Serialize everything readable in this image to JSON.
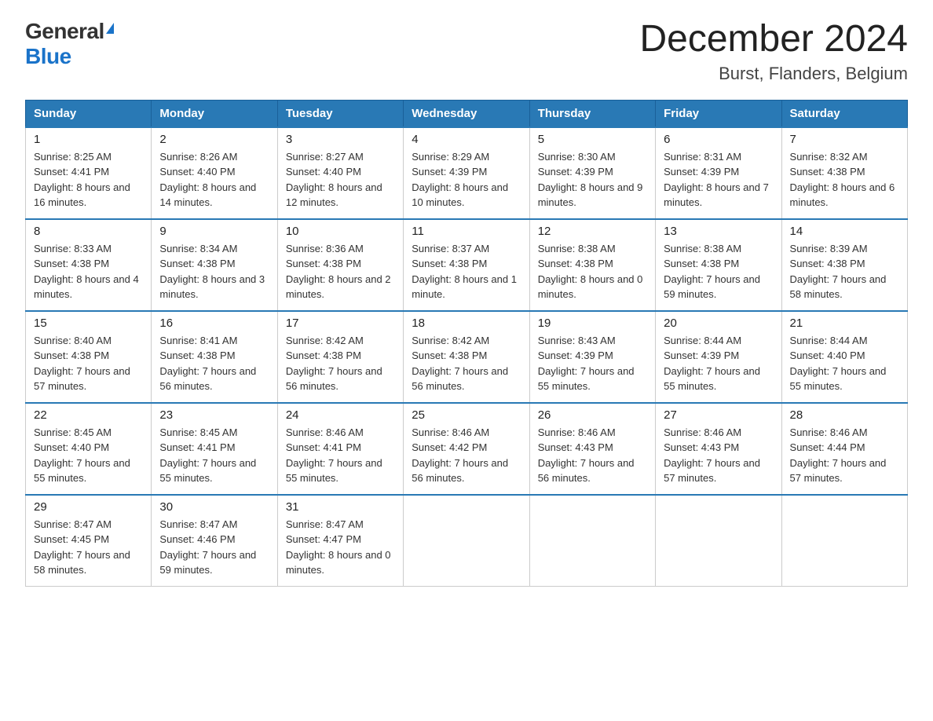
{
  "header": {
    "logo_general": "General",
    "logo_blue": "Blue",
    "title": "December 2024",
    "location": "Burst, Flanders, Belgium"
  },
  "days_of_week": [
    "Sunday",
    "Monday",
    "Tuesday",
    "Wednesday",
    "Thursday",
    "Friday",
    "Saturday"
  ],
  "weeks": [
    [
      {
        "num": "1",
        "sunrise": "8:25 AM",
        "sunset": "4:41 PM",
        "daylight": "8 hours and 16 minutes."
      },
      {
        "num": "2",
        "sunrise": "8:26 AM",
        "sunset": "4:40 PM",
        "daylight": "8 hours and 14 minutes."
      },
      {
        "num": "3",
        "sunrise": "8:27 AM",
        "sunset": "4:40 PM",
        "daylight": "8 hours and 12 minutes."
      },
      {
        "num": "4",
        "sunrise": "8:29 AM",
        "sunset": "4:39 PM",
        "daylight": "8 hours and 10 minutes."
      },
      {
        "num": "5",
        "sunrise": "8:30 AM",
        "sunset": "4:39 PM",
        "daylight": "8 hours and 9 minutes."
      },
      {
        "num": "6",
        "sunrise": "8:31 AM",
        "sunset": "4:39 PM",
        "daylight": "8 hours and 7 minutes."
      },
      {
        "num": "7",
        "sunrise": "8:32 AM",
        "sunset": "4:38 PM",
        "daylight": "8 hours and 6 minutes."
      }
    ],
    [
      {
        "num": "8",
        "sunrise": "8:33 AM",
        "sunset": "4:38 PM",
        "daylight": "8 hours and 4 minutes."
      },
      {
        "num": "9",
        "sunrise": "8:34 AM",
        "sunset": "4:38 PM",
        "daylight": "8 hours and 3 minutes."
      },
      {
        "num": "10",
        "sunrise": "8:36 AM",
        "sunset": "4:38 PM",
        "daylight": "8 hours and 2 minutes."
      },
      {
        "num": "11",
        "sunrise": "8:37 AM",
        "sunset": "4:38 PM",
        "daylight": "8 hours and 1 minute."
      },
      {
        "num": "12",
        "sunrise": "8:38 AM",
        "sunset": "4:38 PM",
        "daylight": "8 hours and 0 minutes."
      },
      {
        "num": "13",
        "sunrise": "8:38 AM",
        "sunset": "4:38 PM",
        "daylight": "7 hours and 59 minutes."
      },
      {
        "num": "14",
        "sunrise": "8:39 AM",
        "sunset": "4:38 PM",
        "daylight": "7 hours and 58 minutes."
      }
    ],
    [
      {
        "num": "15",
        "sunrise": "8:40 AM",
        "sunset": "4:38 PM",
        "daylight": "7 hours and 57 minutes."
      },
      {
        "num": "16",
        "sunrise": "8:41 AM",
        "sunset": "4:38 PM",
        "daylight": "7 hours and 56 minutes."
      },
      {
        "num": "17",
        "sunrise": "8:42 AM",
        "sunset": "4:38 PM",
        "daylight": "7 hours and 56 minutes."
      },
      {
        "num": "18",
        "sunrise": "8:42 AM",
        "sunset": "4:38 PM",
        "daylight": "7 hours and 56 minutes."
      },
      {
        "num": "19",
        "sunrise": "8:43 AM",
        "sunset": "4:39 PM",
        "daylight": "7 hours and 55 minutes."
      },
      {
        "num": "20",
        "sunrise": "8:44 AM",
        "sunset": "4:39 PM",
        "daylight": "7 hours and 55 minutes."
      },
      {
        "num": "21",
        "sunrise": "8:44 AM",
        "sunset": "4:40 PM",
        "daylight": "7 hours and 55 minutes."
      }
    ],
    [
      {
        "num": "22",
        "sunrise": "8:45 AM",
        "sunset": "4:40 PM",
        "daylight": "7 hours and 55 minutes."
      },
      {
        "num": "23",
        "sunrise": "8:45 AM",
        "sunset": "4:41 PM",
        "daylight": "7 hours and 55 minutes."
      },
      {
        "num": "24",
        "sunrise": "8:46 AM",
        "sunset": "4:41 PM",
        "daylight": "7 hours and 55 minutes."
      },
      {
        "num": "25",
        "sunrise": "8:46 AM",
        "sunset": "4:42 PM",
        "daylight": "7 hours and 56 minutes."
      },
      {
        "num": "26",
        "sunrise": "8:46 AM",
        "sunset": "4:43 PM",
        "daylight": "7 hours and 56 minutes."
      },
      {
        "num": "27",
        "sunrise": "8:46 AM",
        "sunset": "4:43 PM",
        "daylight": "7 hours and 57 minutes."
      },
      {
        "num": "28",
        "sunrise": "8:46 AM",
        "sunset": "4:44 PM",
        "daylight": "7 hours and 57 minutes."
      }
    ],
    [
      {
        "num": "29",
        "sunrise": "8:47 AM",
        "sunset": "4:45 PM",
        "daylight": "7 hours and 58 minutes."
      },
      {
        "num": "30",
        "sunrise": "8:47 AM",
        "sunset": "4:46 PM",
        "daylight": "7 hours and 59 minutes."
      },
      {
        "num": "31",
        "sunrise": "8:47 AM",
        "sunset": "4:47 PM",
        "daylight": "8 hours and 0 minutes."
      },
      null,
      null,
      null,
      null
    ]
  ]
}
